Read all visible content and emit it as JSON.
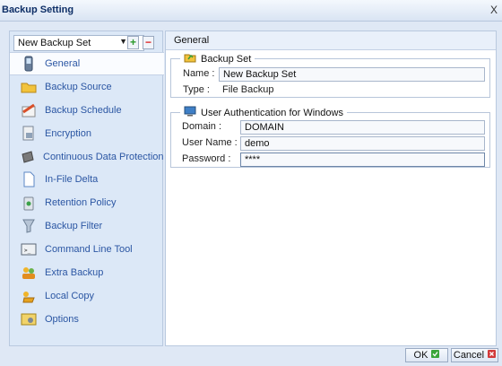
{
  "window": {
    "title": "Backup Setting",
    "close": "X"
  },
  "backup_set_select": {
    "value": "New Backup Set"
  },
  "sidebar": {
    "items": [
      {
        "label": "General",
        "icon": "phone-icon",
        "active": true
      },
      {
        "label": "Backup Source",
        "icon": "folder-icon"
      },
      {
        "label": "Backup Schedule",
        "icon": "calendar-icon"
      },
      {
        "label": "Encryption",
        "icon": "encryption-icon"
      },
      {
        "label": "Continuous Data Protection",
        "icon": "shield-icon"
      },
      {
        "label": "In-File Delta",
        "icon": "document-icon"
      },
      {
        "label": "Retention Policy",
        "icon": "recycle-bin-icon"
      },
      {
        "label": "Backup Filter",
        "icon": "funnel-icon"
      },
      {
        "label": "Command Line Tool",
        "icon": "terminal-icon"
      },
      {
        "label": "Extra Backup",
        "icon": "people-icon"
      },
      {
        "label": "Local Copy",
        "icon": "copy-icon"
      },
      {
        "label": "Options",
        "icon": "options-icon"
      }
    ]
  },
  "main": {
    "header": "General",
    "backup_set_group": {
      "title": "Backup Set",
      "name_label": "Name :",
      "name_value": "New Backup Set",
      "type_label": "Type :",
      "type_value": "File Backup"
    },
    "auth_group": {
      "title": "User Authentication for Windows",
      "domain_label": "Domain :",
      "domain_value": "DOMAIN",
      "username_label": "User Name :",
      "username_value": "demo",
      "password_label": "Password :",
      "password_value": "****"
    }
  },
  "buttons": {
    "ok": "OK",
    "cancel": "Cancel"
  },
  "colors": {
    "accent": "#2b56a3",
    "title": "#0d2e66",
    "panel": "#dce8f7"
  }
}
